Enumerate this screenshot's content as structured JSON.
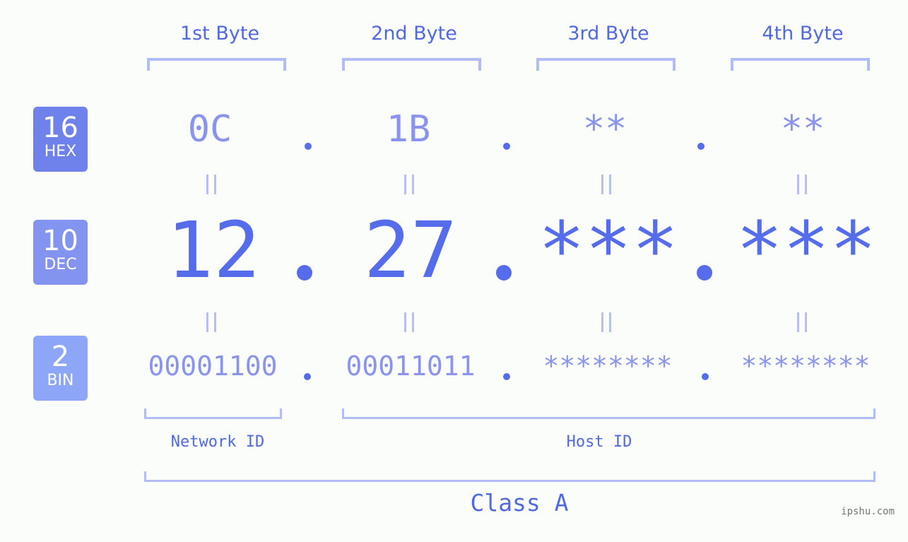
{
  "byte_headers": [
    "1st Byte",
    "2nd Byte",
    "3rd Byte",
    "4th Byte"
  ],
  "badges": [
    {
      "num": "16",
      "label": "HEX",
      "color": "#6f81ea"
    },
    {
      "num": "10",
      "label": "DEC",
      "color": "#8293f0"
    },
    {
      "num": "2",
      "label": "BIN",
      "color": "#8ea6f8"
    }
  ],
  "hex": [
    "0C",
    "1B",
    "**",
    "**"
  ],
  "dec": [
    "12",
    "27",
    "***",
    "***"
  ],
  "bin": [
    "00001100",
    "00011011",
    "********",
    "********"
  ],
  "network_label": "Network ID",
  "host_label": "Host ID",
  "class_label": "Class A",
  "watermark": "ipshu.com",
  "colors": {
    "accent": "#556ceb",
    "light": "#8a94ec",
    "bracket": "#b2bcf6"
  }
}
